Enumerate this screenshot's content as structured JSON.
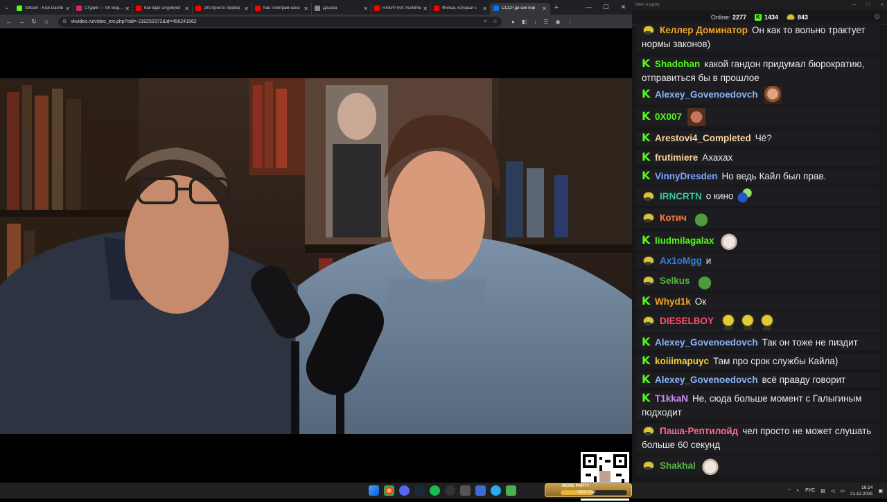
{
  "browser": {
    "tabs": [
      {
        "title": "Stream - Kick Dashb",
        "favicon_color": "#53fc18"
      },
      {
        "title": "Студия — VK Видео",
        "favicon_color": "#e0245e"
      },
      {
        "title": "Как ВДВ штурмуют",
        "favicon_color": "#ff0000"
      },
      {
        "title": "Это просто провер",
        "favicon_color": "#ff0000"
      },
      {
        "title": "Как Телеграм-кана",
        "favicon_color": "#ff0000"
      },
      {
        "title": "Дзьора",
        "favicon_color": "#888888"
      },
      {
        "title": "НАКРУТКА УБИВАЕ",
        "favicon_color": "#ff0000"
      },
      {
        "title": "Фильм, который с",
        "favicon_color": "#ff0000"
      },
      {
        "title": "СССР до сих пор",
        "favicon_color": "#0077ff",
        "active": true
      }
    ],
    "url": "vkvideo.ru/video_ext.php?oid=-219252372&id=456241562",
    "controls": {
      "minimize": "—",
      "maximize": "☐",
      "close": "✕"
    }
  },
  "chat": {
    "window_title": "Окно в дурку",
    "online_label": "Online:",
    "online_count": "2277",
    "kick_count": "1434",
    "twitch_count": "843",
    "messages": [
      {
        "platform": "twitch",
        "nick": "Келлер Доминатор",
        "color": "#f5a623",
        "text": "Он как то вольно трактует нормы законов)"
      },
      {
        "platform": "kick",
        "nick": "Shadohan",
        "color": "#53fc18",
        "text": "какой гандон придумал бюрократию, отправиться бы в прошлое"
      },
      {
        "platform": "kick",
        "nick": "Alexey_Govenoedovch",
        "color": "#8ab4f8",
        "text": "",
        "emote": "e-face"
      },
      {
        "platform": "kick",
        "nick": "0X007",
        "color": "#53fc18",
        "text": "",
        "emote": "e-face2"
      },
      {
        "platform": "kick",
        "nick": "Arestovi4_Completed",
        "color": "#f8d59c",
        "text": "Чё?"
      },
      {
        "platform": "kick",
        "nick": "frutimiere",
        "color": "#f8d59c",
        "text": "Ахахах"
      },
      {
        "platform": "kick",
        "nick": "VinnyDresden",
        "color": "#7aa7ff",
        "text": "Но ведь Кайл был прав."
      },
      {
        "platform": "twitch",
        "nick": "IRNCRTN",
        "color": "#36c5a5",
        "text": "о кино",
        "emote": "e-blue"
      },
      {
        "platform": "twitch",
        "nick": "Котич",
        "color": "#ff7a3d",
        "text": "",
        "emote": "e-frog"
      },
      {
        "platform": "kick",
        "nick": "liudmilagalax",
        "color": "#53fc18",
        "text": "",
        "emote": "e-cat"
      },
      {
        "platform": "twitch",
        "nick": "Ax1oMgg",
        "color": "#2f7fd8",
        "text": "и"
      },
      {
        "platform": "twitch",
        "nick": "Selkus",
        "color": "#53b83b",
        "text": "",
        "emote": "e-frog"
      },
      {
        "platform": "kick",
        "nick": "Whyd1k",
        "color": "#f5a623",
        "text": "Ок"
      },
      {
        "platform": "twitch",
        "nick": "DIESELBOY",
        "color": "#ff4f6d",
        "text": "",
        "emote": "e-pepe"
      },
      {
        "platform": "kick",
        "nick": "Alexey_Govenoedovch",
        "color": "#8ab4f8",
        "text": "Так он тоже не пиздит"
      },
      {
        "platform": "kick",
        "nick": "koiiimapuyc",
        "color": "#f5d13d",
        "text": "Там про срок службы Кайла)"
      },
      {
        "platform": "kick",
        "nick": "Alexey_Govenoedovch",
        "color": "#8ab4f8",
        "text": "всё правду говорит"
      },
      {
        "platform": "kick",
        "nick": "T1kkaN",
        "color": "#d28cf5",
        "text": "Не, сюда больше момент с Галыгиным подходит"
      },
      {
        "platform": "twitch",
        "nick": "Паша-Рептилойд",
        "color": "#ff6b8a",
        "text": "чел просто не может слушать больше 60 секунд"
      },
      {
        "platform": "twitch",
        "nick": "Shakhal",
        "color": "#53b83b",
        "text": "",
        "emote": "e-cat"
      }
    ]
  },
  "taskbar": {
    "widget_title": "MEME PARTY",
    "widget_progress_text": "1250 / 1500",
    "widget_progress": 0.5,
    "lang": "РУС",
    "time": "16:14",
    "date": "21.12.2025"
  }
}
